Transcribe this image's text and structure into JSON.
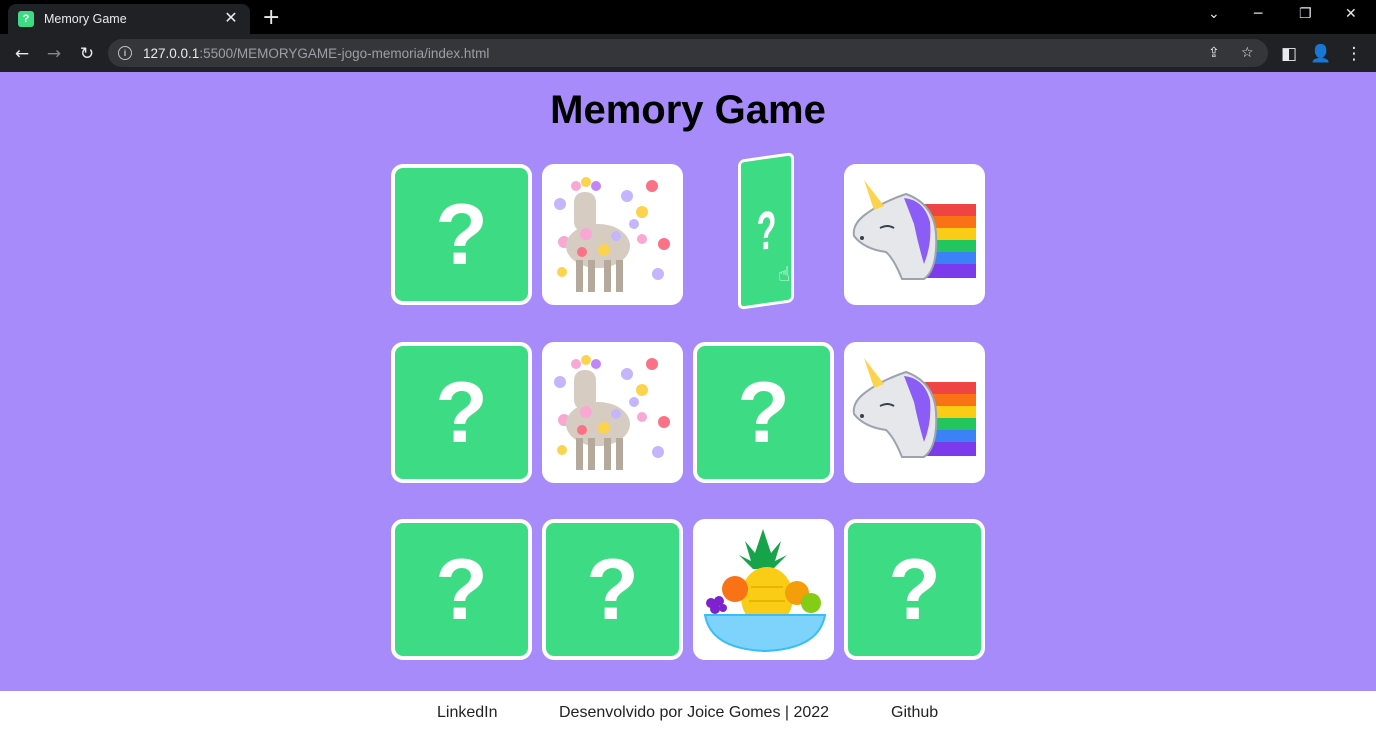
{
  "browser": {
    "tab_title": "Memory Game",
    "tab_favicon": "?",
    "tab_close": "✕",
    "new_tab": "+",
    "url_host": "127.0.0.1",
    "url_rest": ":5500/MEMORYGAME-jogo-memoria/index.html",
    "icons": [
      "back-arrow-icon",
      "forward-arrow-icon",
      "reload-icon",
      "info-icon",
      "share-icon",
      "star-icon",
      "side-panel-icon",
      "profile-icon",
      "menu-icon"
    ]
  },
  "page": {
    "title": "Memory Game",
    "card_back_symbol": "?",
    "colors": {
      "background": "#a78bfa",
      "card_back": "#3ddc84",
      "card_border": "#ffffff"
    },
    "cards": [
      {
        "state": "hidden"
      },
      {
        "state": "revealed",
        "image": "llama-icon"
      },
      {
        "state": "flipping"
      },
      {
        "state": "revealed",
        "image": "unicorn-icon"
      },
      {
        "state": "hidden"
      },
      {
        "state": "revealed",
        "image": "llama-icon"
      },
      {
        "state": "hidden"
      },
      {
        "state": "revealed",
        "image": "unicorn-icon"
      },
      {
        "state": "hidden"
      },
      {
        "state": "hidden"
      },
      {
        "state": "revealed",
        "image": "fruit-bowl-icon"
      },
      {
        "state": "hidden"
      }
    ]
  },
  "footer": {
    "linkedin": "LinkedIn",
    "credit": "Desenvolvido por Joice Gomes | 2022",
    "github": "Github"
  }
}
